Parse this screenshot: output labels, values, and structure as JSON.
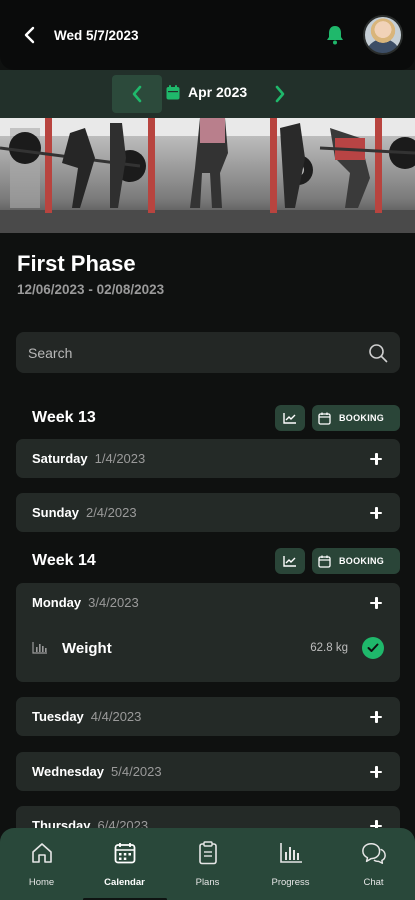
{
  "header": {
    "date": "Wed 5/7/2023",
    "back_icon": "chevron-left-icon",
    "bell_icon": "bell-icon",
    "accent_color": "#1fb86b"
  },
  "month_nav": {
    "label": "Apr 2023",
    "prev_icon": "chevron-left-icon",
    "next_icon": "chevron-right-icon",
    "calendar_icon": "calendar-icon"
  },
  "plan": {
    "title": "First Phase",
    "date_range": "12/06/2023 - 02/08/2023"
  },
  "search": {
    "placeholder": "Search"
  },
  "weeks": [
    {
      "title": "Week 13",
      "booking_label": "BOOKING",
      "days": [
        {
          "name": "Saturday",
          "date": "1/4/2023"
        },
        {
          "name": "Sunday",
          "date": "2/4/2023"
        }
      ]
    },
    {
      "title": "Week 14",
      "booking_label": "BOOKING",
      "days": [
        {
          "name": "Monday",
          "date": "3/4/2023",
          "entries": [
            {
              "label": "Weight",
              "value": "62.8 kg",
              "done": true
            }
          ]
        },
        {
          "name": "Tuesday",
          "date": "4/4/2023"
        },
        {
          "name": "Wednesday",
          "date": "5/4/2023"
        },
        {
          "name": "Thursday",
          "date": "6/4/2023"
        }
      ]
    }
  ],
  "bottom_nav": [
    {
      "label": "Home",
      "icon": "home-icon"
    },
    {
      "label": "Calendar",
      "icon": "calendar-icon",
      "active": true
    },
    {
      "label": "Plans",
      "icon": "clipboard-icon"
    },
    {
      "label": "Progress",
      "icon": "bar-chart-icon"
    },
    {
      "label": "Chat",
      "icon": "chat-icon"
    }
  ]
}
